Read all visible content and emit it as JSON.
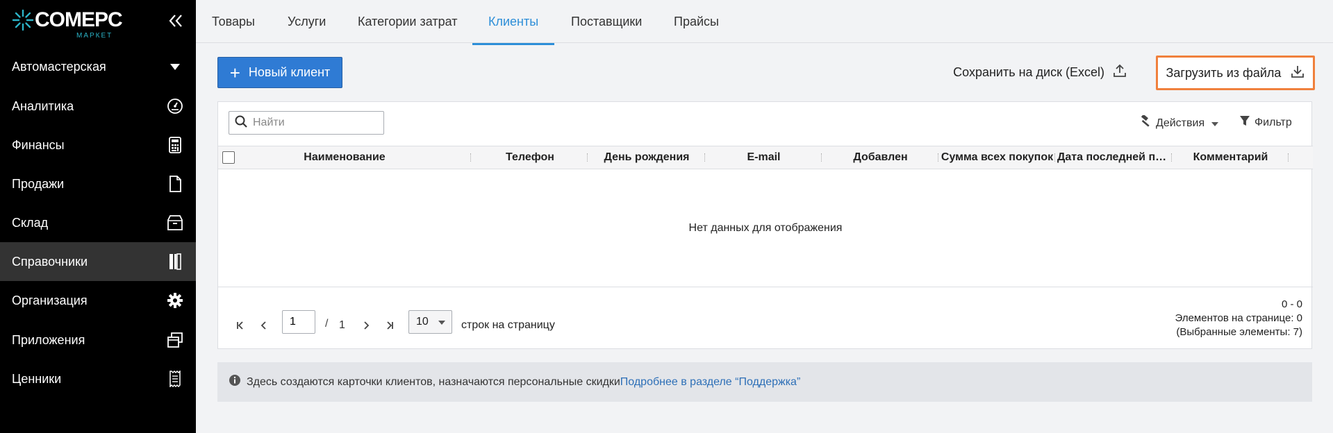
{
  "brand": {
    "name": "COMEPC",
    "sub": "МАРКЕТ",
    "accent": "#2bb3c7"
  },
  "sidebar": {
    "items": [
      {
        "label": "Автомастерская",
        "icon": "caret-down-icon"
      },
      {
        "label": "Аналитика",
        "icon": "gauge-icon"
      },
      {
        "label": "Финансы",
        "icon": "calculator-icon"
      },
      {
        "label": "Продажи",
        "icon": "document-icon"
      },
      {
        "label": "Склад",
        "icon": "box-icon"
      },
      {
        "label": "Справочники",
        "icon": "book-icon",
        "active": true
      },
      {
        "label": "Организация",
        "icon": "gear-icon"
      },
      {
        "label": "Приложения",
        "icon": "windows-icon"
      },
      {
        "label": "Ценники",
        "icon": "receipt-icon"
      }
    ]
  },
  "tabs": [
    {
      "label": "Товары"
    },
    {
      "label": "Услуги"
    },
    {
      "label": "Категории затрат"
    },
    {
      "label": "Клиенты",
      "active": true
    },
    {
      "label": "Поставщики"
    },
    {
      "label": "Прайсы"
    }
  ],
  "toolbar": {
    "new_client": "Новый клиент",
    "save_excel": "Сохранить на диск (Excel)",
    "load_file": "Загрузить из файла"
  },
  "grid": {
    "search_placeholder": "Найти",
    "actions_label": "Действия",
    "filter_label": "Фильтр",
    "columns": [
      "Наименование",
      "Телефон",
      "День рождения",
      "E-mail",
      "Добавлен",
      "Сумма всех покупок",
      "Дата последней покупки",
      "Комментарий"
    ],
    "empty_text": "Нет данных для отображения"
  },
  "pager": {
    "current_page": "1",
    "slash": "/",
    "total_pages": "1",
    "page_size": "10",
    "page_size_label": "строк на страницу",
    "range": "0 - 0",
    "items_per_page": "Элементов на странице: 0",
    "selected": "(Выбранные элементы: 7)"
  },
  "banner": {
    "text": "Здесь создаются карточки клиентов, назначаются персональные скидки",
    "link": "Подробнее в разделе “Поддержка”"
  },
  "colors": {
    "primary": "#2f7bd4",
    "highlight": "#f0803c",
    "tab_active": "#2d8ed8",
    "sidebar_bg": "#000000"
  }
}
